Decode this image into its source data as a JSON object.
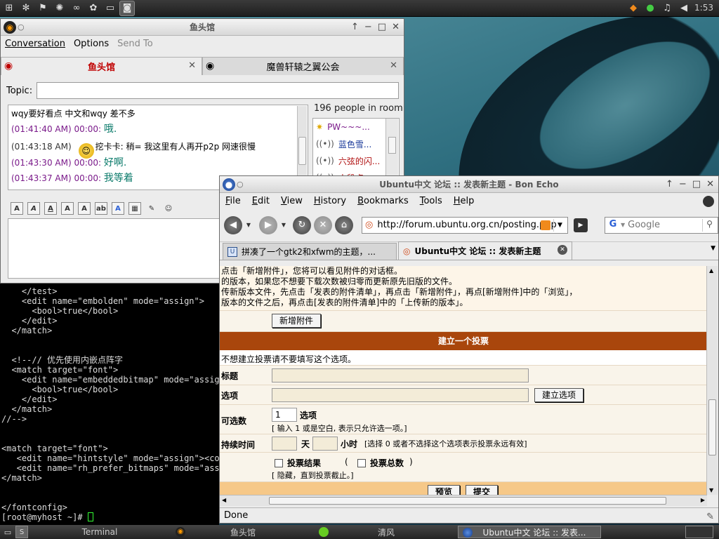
{
  "colors": {
    "accent_orange": "#a9460c",
    "chat_timestamp": "#7a1a8a",
    "chat_message": "#0a7a6a",
    "tab_active_red": "#c00000"
  },
  "top_panel": {
    "launchers": [
      "windows-logo-icon",
      "gear-icon",
      "flag-icon",
      "pinwheel-icon",
      "circles-icon",
      "paw-icon",
      "window-icon",
      "camera-icon"
    ],
    "tray": [
      "fox-icon",
      "network-icon",
      "music-icon",
      "volume-icon"
    ],
    "clock": "1:53"
  },
  "qq_window": {
    "title": "鱼头馆",
    "menu": [
      "Conversation",
      "Options",
      "Send To"
    ],
    "tabs": [
      {
        "label": "鱼头馆"
      },
      {
        "label": "魔兽轩辕之翼公会"
      }
    ],
    "topic_label": "Topic:",
    "topic_value": "",
    "chat_lines": [
      {
        "ts": "",
        "text": "wqy要好看点 中文和wqy 差不多"
      },
      {
        "ts": "(01:41:40 AM) 00:00:",
        "text": "哦."
      },
      {
        "ts": "(01:43:18 AM)",
        "text": "挖卡卡: 稍= 我这里有人再开p2p  网速很慢"
      },
      {
        "ts": "(01:43:30 AM) 00:00:",
        "text": "好啊."
      },
      {
        "ts": "(01:43:37 AM) 00:00:",
        "text": "我等着"
      }
    ],
    "room_count": "196 people in room",
    "members": [
      "PW~~~...",
      "蓝色雪...",
      "六弦的闪...",
      "小段点..."
    ],
    "toolbar": [
      "A",
      "A",
      "A",
      "A",
      "A",
      "ab",
      "A",
      "▦",
      "✎",
      "☺"
    ]
  },
  "terminal": {
    "lines": [
      "    </test>",
      "    <edit name=\"embolden\" mode=\"assign\">",
      "      <bool>true</bool>",
      "    </edit>",
      "  </match>",
      "",
      "",
      "  <!--// 优先使用内嵌点阵字",
      "  <match target=\"font\">",
      "    <edit name=\"embeddedbitmap\" mode=\"assign",
      "      <bool>true</bool>",
      "    </edit>",
      "  </match>",
      "//-->",
      "",
      "",
      "<match target=\"font\">",
      "   <edit name=\"hintstyle\" mode=\"assign\"><cons",
      "   <edit name=\"rh_prefer_bitmaps\" mode=\"assig",
      "</match>",
      "",
      "",
      "</fontconfig>"
    ],
    "prompt": "[root@myhost ~]# "
  },
  "browser": {
    "title": "Ubuntu中文 论坛 :: 发表新主题 - Bon Echo",
    "menu": [
      "File",
      "Edit",
      "View",
      "History",
      "Bookmarks",
      "Tools",
      "Help"
    ],
    "url": "http://forum.ubuntu.org.cn/posting.php",
    "search_placeholder": "Google",
    "tabs": [
      {
        "label": "拼凑了一个gtk2和xfwm的主题，..."
      },
      {
        "label": "Ubuntu中文 论坛 :: 发表新主题"
      }
    ],
    "page": {
      "info_lines": [
        "点击「新增附件」，您将可以看见附件的对话框。",
        "的版本，如果您不想要下载次数被归零而更新原先旧版的文件。",
        "传新版本文件，先点击「发表的附件清单」，再点击「新增附件」，再点[新增附件]中的「浏览」，",
        "版本的文件之后，再点击[发表的附件清单]中的「上传新的版本」。"
      ],
      "add_attachment_button": "新增附件",
      "poll_header": "建立一个投票",
      "poll_note": "不想建立投票请不要填写这个选项。",
      "question_label": "标题",
      "option_label": "选项",
      "create_option_button": "建立选项",
      "max_choices_label": "可选数",
      "max_choices_value": "1",
      "max_choices_unit": "选项",
      "max_choices_hint": "[ 输入 1 或是空白, 表示只允许选一项。]",
      "duration_label": "持续时间",
      "days_unit": "天",
      "hours_unit": "小时",
      "duration_hint": "[选择 0 或者不选择这个选项表示投票永远有效]",
      "hide_results_label": "投票结果",
      "hide_total_label": "投票总数",
      "paren_open": "(",
      "paren_close": ")",
      "hide_hint": "[ 隐藏，直到投票截止。]",
      "preview_button": "预览",
      "submit_button": "提交"
    },
    "status": "Done"
  },
  "taskbar": {
    "tasks": [
      {
        "label": "Terminal"
      },
      {
        "label": "鱼头馆"
      },
      {
        "label": "清风"
      },
      {
        "label": "Ubuntu中文 论坛 :: 发表..."
      }
    ]
  }
}
